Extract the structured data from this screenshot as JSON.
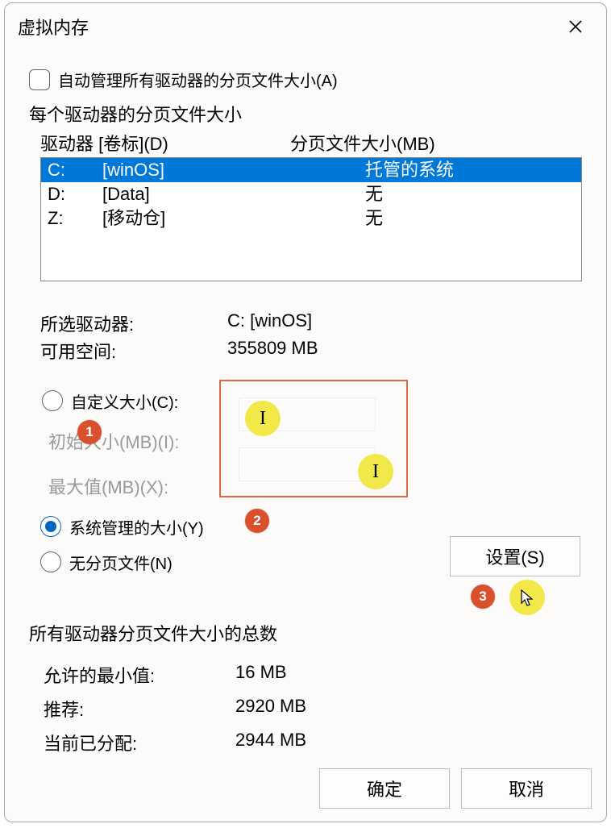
{
  "title": "虚拟内存",
  "auto_manage_label": "自动管理所有驱动器的分页文件大小(A)",
  "per_drive_header": "每个驱动器的分页文件大小",
  "columns": {
    "drive": "驱动器 [卷标](D)",
    "size": "分页文件大小(MB)"
  },
  "drives": [
    {
      "letter": "C:",
      "label": "[winOS]",
      "paging": "托管的系统",
      "selected": true
    },
    {
      "letter": "D:",
      "label": "[Data]",
      "paging": "无",
      "selected": false
    },
    {
      "letter": "Z:",
      "label": "[移动仓]",
      "paging": "无",
      "selected": false
    }
  ],
  "selected": {
    "drive_label": "所选驱动器:",
    "drive_value": "C:  [winOS]",
    "free_label": "可用空间:",
    "free_value": "355809 MB"
  },
  "options": {
    "custom": "自定义大小(C):",
    "initial": "初始大小(MB)(I):",
    "max": "最大值(MB)(X):",
    "system_managed": "系统管理的大小(Y)",
    "no_paging": "无分页文件(N)",
    "set_btn": "设置(S)"
  },
  "totals": {
    "header": "所有驱动器分页文件大小的总数",
    "min_label": "允许的最小值:",
    "min_value": "16 MB",
    "rec_label": "推荐:",
    "rec_value": "2920 MB",
    "cur_label": "当前已分配:",
    "cur_value": "2944 MB"
  },
  "buttons": {
    "ok": "确定",
    "cancel": "取消"
  },
  "annotations": {
    "m1": "1",
    "m2": "2",
    "m3": "3"
  }
}
